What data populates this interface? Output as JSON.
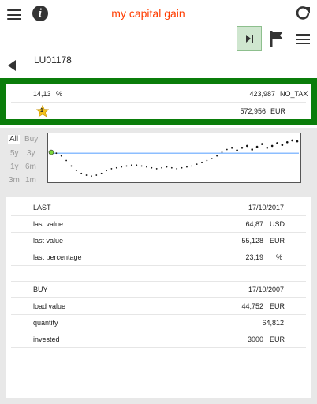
{
  "header": {
    "title": "my capital gain"
  },
  "instrument": {
    "code": "LU01178"
  },
  "summary": {
    "percent_value": "14,13",
    "percent_unit": "%",
    "amount": "423,987",
    "tax": "NO_TAX",
    "star_number": "1",
    "value": "572,956",
    "currency": "EUR"
  },
  "periods": [
    "All",
    "Buy",
    "5y",
    "3y",
    "1y",
    "6m",
    "3m",
    "1m"
  ],
  "active_period": "All",
  "chart_data": {
    "type": "line",
    "description_series": [
      {
        "values": [
          61,
          60,
          57,
          52,
          46,
          41,
          38,
          36,
          35,
          36,
          38,
          41,
          43,
          44,
          45,
          46,
          47,
          47,
          46,
          45,
          44,
          43,
          44,
          45,
          44,
          43,
          44,
          45,
          46,
          48,
          50,
          52,
          54,
          57,
          61,
          64,
          66,
          63,
          66,
          68,
          64,
          67,
          70,
          66,
          68,
          71,
          69,
          72,
          74,
          73
        ]
      }
    ],
    "reference_line": 60,
    "ylim": [
      30,
      80
    ],
    "grid": false
  },
  "last": {
    "header_label": "LAST",
    "header_date": "17/10/2017",
    "rows": [
      {
        "label": "last value",
        "value": "64,87",
        "unit": "USD"
      },
      {
        "label": "last value",
        "value": "55,128",
        "unit": "EUR"
      },
      {
        "label": "last percentage",
        "value": "23,19",
        "unit": "%"
      }
    ]
  },
  "buy": {
    "header_label": "BUY",
    "header_date": "17/10/2007",
    "rows": [
      {
        "label": "load value",
        "value": "44,752",
        "unit": "EUR"
      },
      {
        "label": "quantity",
        "value": "64,812",
        "unit": ""
      },
      {
        "label": "invested",
        "value": "3000",
        "unit": "EUR"
      }
    ]
  },
  "colors": {
    "accent": "#ff3d00",
    "green": "#0a7d0a",
    "line": "#66a8ff"
  }
}
